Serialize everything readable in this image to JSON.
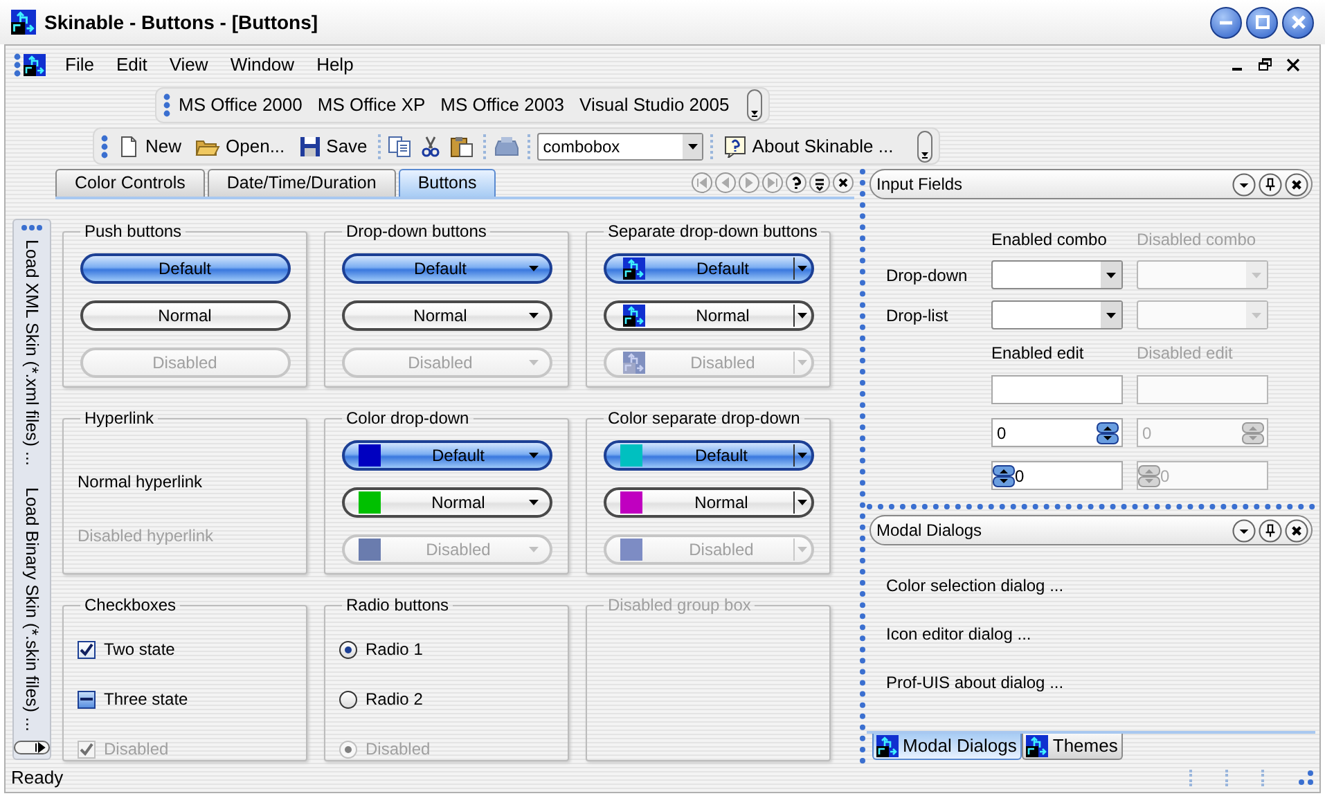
{
  "window": {
    "title": "Skinable - Buttons - [Buttons]"
  },
  "menu": [
    "File",
    "Edit",
    "View",
    "Window",
    "Help"
  ],
  "themes_toolbar": [
    "MS Office 2000",
    "MS Office XP",
    "MS Office 2003",
    "Visual Studio 2005"
  ],
  "toolbar": {
    "buttons": [
      "New",
      "Open...",
      "Save"
    ],
    "combobox": {
      "value": "combobox"
    },
    "about": "About Skinable ..."
  },
  "side_bar": {
    "items": [
      "Load XML Skin (*.xml files) ...",
      "Load Binary Skin (*.skin files) ..."
    ]
  },
  "tabs": [
    {
      "label": "Color Controls",
      "selected": false
    },
    {
      "label": "Date/Time/Duration",
      "selected": false
    },
    {
      "label": "Buttons",
      "selected": true
    }
  ],
  "groups": [
    {
      "title": "Push buttons",
      "kind": "push",
      "disabled": false,
      "items": [
        {
          "label": "Default",
          "default": true,
          "disabled": false
        },
        {
          "label": "Normal",
          "default": false,
          "disabled": false
        },
        {
          "label": "Disabled",
          "disabled": true
        }
      ]
    },
    {
      "title": "Drop-down buttons",
      "kind": "dropdown",
      "disabled": false,
      "items": [
        {
          "label": "Default",
          "default": true,
          "disabled": false
        },
        {
          "label": "Normal",
          "default": false,
          "disabled": false
        },
        {
          "label": "Disabled",
          "disabled": true
        }
      ]
    },
    {
      "title": "Separate drop-down buttons",
      "kind": "split",
      "disabled": false,
      "items": [
        {
          "label": "Default",
          "default": true,
          "disabled": false
        },
        {
          "label": "Normal",
          "default": false,
          "disabled": false
        },
        {
          "label": "Disabled",
          "disabled": true
        }
      ]
    },
    {
      "title": "Hyperlink",
      "kind": "hyperlink",
      "disabled": false,
      "items": [
        {
          "label": "Normal hyperlink",
          "disabled": false
        },
        {
          "label": "Disabled hyperlink",
          "disabled": true
        }
      ]
    },
    {
      "title": "Color drop-down",
      "kind": "color_dropdown",
      "disabled": false,
      "items": [
        {
          "label": "Default",
          "default": true,
          "disabled": false,
          "color": "#0000c0"
        },
        {
          "label": "Normal",
          "default": false,
          "disabled": false,
          "color": "#00c000"
        },
        {
          "label": "Disabled",
          "disabled": true,
          "color": "#6a7cae"
        }
      ]
    },
    {
      "title": "Color separate drop-down",
      "kind": "color_split",
      "disabled": false,
      "items": [
        {
          "label": "Default",
          "default": true,
          "disabled": false,
          "color": "#00c0c0"
        },
        {
          "label": "Normal",
          "default": false,
          "disabled": false,
          "color": "#c000c0"
        },
        {
          "label": "Disabled",
          "disabled": true,
          "color": "#7d8cc4"
        }
      ]
    },
    {
      "title": "Checkboxes",
      "kind": "checkbox",
      "disabled": false,
      "items": [
        {
          "label": "Two state",
          "checked": true,
          "disabled": false
        },
        {
          "label": "Three state",
          "checked": true,
          "mixed": true,
          "disabled": false
        },
        {
          "label": "Disabled",
          "checked": true,
          "disabled": true
        }
      ]
    },
    {
      "title": "Radio buttons",
      "kind": "radio",
      "disabled": false,
      "items": [
        {
          "label": "Radio 1",
          "selected": true,
          "disabled": false
        },
        {
          "label": "Radio 2",
          "selected": false,
          "disabled": false
        },
        {
          "label": "Disabled",
          "selected": true,
          "disabled": true
        }
      ]
    },
    {
      "title": "Disabled group box",
      "kind": "empty",
      "disabled": true
    }
  ],
  "input_fields": {
    "title": "Input Fields",
    "combo_headers": [
      {
        "label": "Enabled combo",
        "disabled": false
      },
      {
        "label": "Disabled combo",
        "disabled": true
      }
    ],
    "combo_rows": [
      "Drop-down",
      "Drop-list"
    ],
    "edit_headers": [
      {
        "label": "Enabled edit",
        "disabled": false
      },
      {
        "label": "Disabled edit",
        "disabled": true
      }
    ],
    "edits": [
      {
        "kind": "plain"
      },
      {
        "kind": "spin_right",
        "values": [
          "0",
          "0"
        ]
      },
      {
        "kind": "spin_left",
        "values": [
          "0",
          "0"
        ]
      }
    ]
  },
  "modal_dialogs": {
    "title": "Modal Dialogs",
    "links": [
      "Color selection dialog ...",
      "Icon editor dialog ...",
      "Prof-UIS about dialog ..."
    ]
  },
  "pane_tabs": [
    {
      "label": "Modal Dialogs",
      "selected": true
    },
    {
      "label": "Themes",
      "selected": false
    }
  ],
  "status_bar": {
    "text": "Ready"
  }
}
